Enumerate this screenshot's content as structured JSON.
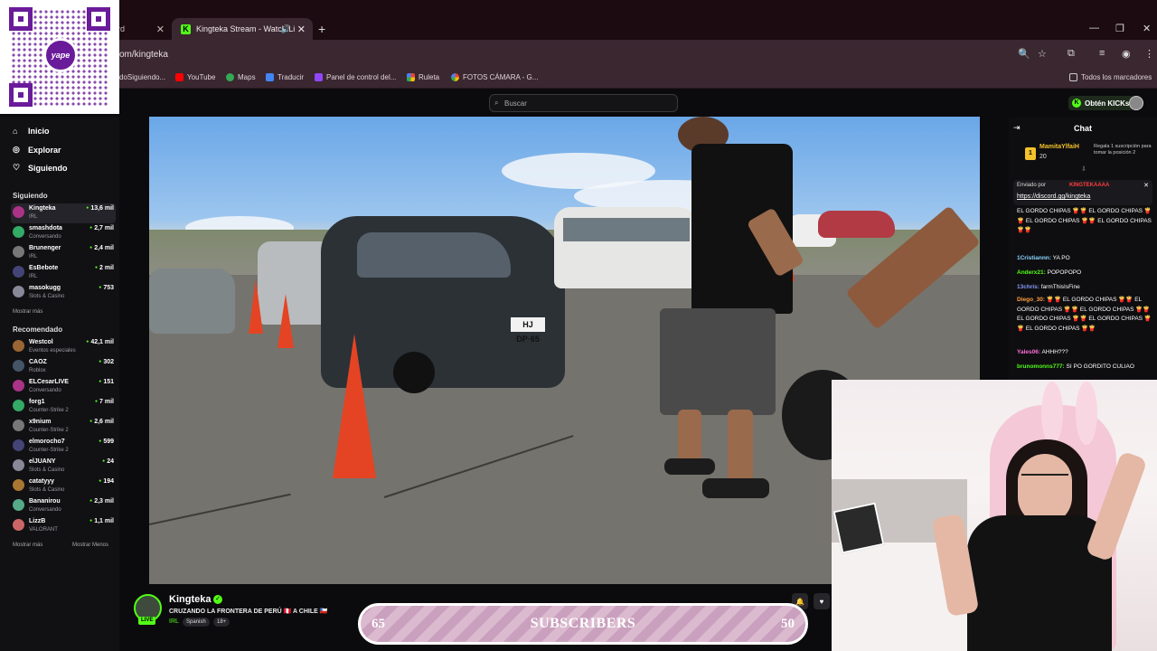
{
  "browser": {
    "tabs": [
      {
        "label": "rd",
        "active": false
      },
      {
        "label": "Kingteka Stream - Watch Li",
        "active": true
      }
    ],
    "url": "om/kingteka",
    "bookmarks": [
      "doSiguiendo...",
      "YouTube",
      "Maps",
      "Traducir",
      "Panel de control del...",
      "Ruleta",
      "FOTOS CÁMARA - G..."
    ],
    "all_bookmarks": "Todos los marcadores"
  },
  "qr": {
    "brand": "yape"
  },
  "header": {
    "search_placeholder": "Buscar",
    "get_kicks": "Obtén KICKs"
  },
  "sidebar": {
    "nav": [
      {
        "label": "Inicio",
        "icon": "home-icon"
      },
      {
        "label": "Explorar",
        "icon": "compass-icon"
      },
      {
        "label": "Siguiendo",
        "icon": "heart-icon"
      }
    ],
    "following_title": "Siguiendo",
    "following": [
      {
        "name": "Kingteka",
        "category": "IRL",
        "viewers": "13,6 mil"
      },
      {
        "name": "smashdota",
        "category": "Conversando",
        "viewers": "2,7 mil"
      },
      {
        "name": "Brunenger",
        "category": "IRL",
        "viewers": "2,4 mil"
      },
      {
        "name": "EsBebote",
        "category": "IRL",
        "viewers": "2 mil"
      },
      {
        "name": "masokugg",
        "category": "Slots & Casino",
        "viewers": "753"
      }
    ],
    "show_more_following": "Mostrar más",
    "recommended_title": "Recomendado",
    "recommended": [
      {
        "name": "Westcol",
        "category": "Eventos especiales",
        "viewers": "42,1 mil"
      },
      {
        "name": "CAOZ",
        "category": "Roblox",
        "viewers": "302"
      },
      {
        "name": "ELCesarLIVE",
        "category": "Conversando",
        "viewers": "151"
      },
      {
        "name": "forg1",
        "category": "Counter-Strike 2",
        "viewers": "7 mil"
      },
      {
        "name": "x9nium",
        "category": "Counter-Strike 2",
        "viewers": "2,6 mil"
      },
      {
        "name": "elmorocho7",
        "category": "Counter-Strike 2",
        "viewers": "599"
      },
      {
        "name": "elJUANY",
        "category": "Slots & Casino",
        "viewers": "24"
      },
      {
        "name": "catatyyy",
        "category": "Slots & Casino",
        "viewers": "194"
      },
      {
        "name": "Bananirou",
        "category": "Conversando",
        "viewers": "2,3 mil"
      },
      {
        "name": "LizzB",
        "category": "VALORANT",
        "viewers": "1,1 mil"
      }
    ],
    "show_more": "Mostrar más",
    "show_less": "Mostrar Menos"
  },
  "stream": {
    "streamer": "Kingteka",
    "live": "LIVE",
    "title": "CRUZANDO LA FRONTERA DE PERÚ 🇵🇪 A CHILE 🇨🇱",
    "category": "IRL",
    "tags": [
      "Spanish",
      "18+"
    ],
    "plate": "HJ DP·65"
  },
  "subscribers_bar": {
    "current": "65",
    "label": "SUBSCRIBERS",
    "goal": "50"
  },
  "chat": {
    "title": "Chat",
    "top_gifter": {
      "rank": "1",
      "name": "MamitaYlfaiH",
      "count": "20",
      "message": "Regala 1 suscripción para tomar la posición 2"
    },
    "pinned_by_label": "Enviado por",
    "pinned_by": "KINGTEKAAAA",
    "pinned_link": "https://discord.gg/kingteka",
    "messages": [
      {
        "user": "",
        "text": "EL GORDO CHIPAS 🍟🍟 EL GORDO CHIPAS 🍟🍟 EL GORDO CHIPAS 🍟🍟 EL GORDO CHIPAS 🍟🍟",
        "color": "#ffffff"
      },
      {
        "user": "1Cristiannn:",
        "text": " YA PO",
        "color": "#8ad4ff"
      },
      {
        "user": "Anderx21:",
        "text": " POPOPOPO",
        "color": "#53fc18"
      },
      {
        "user": "13chris:",
        "text": " farmThisIsFine",
        "color": "#8a9dff"
      },
      {
        "user": "Diego_30:",
        "text": " 🍟🍟 EL GORDO CHIPAS 🍟🍟 EL GORDO CHIPAS 🍟🍟 EL GORDO CHIPAS 🍟🍟 EL GORDO CHIPAS 🍟🍟 EL GORDO CHIPAS 🍟🍟 EL GORDO CHIPAS 🍟🍟",
        "color": "#ff9f43"
      },
      {
        "user": "Yales06:",
        "text": " AHHH???",
        "color": "#ff6fd8"
      },
      {
        "user": "brunomonns777:",
        "text": " SI PO GORDITO CULIAO",
        "color": "#53fc18"
      }
    ]
  },
  "colors": {
    "kick_green": "#53fc18",
    "chrome_bg": "#3a2730",
    "page_bg": "#0b0b0d"
  }
}
